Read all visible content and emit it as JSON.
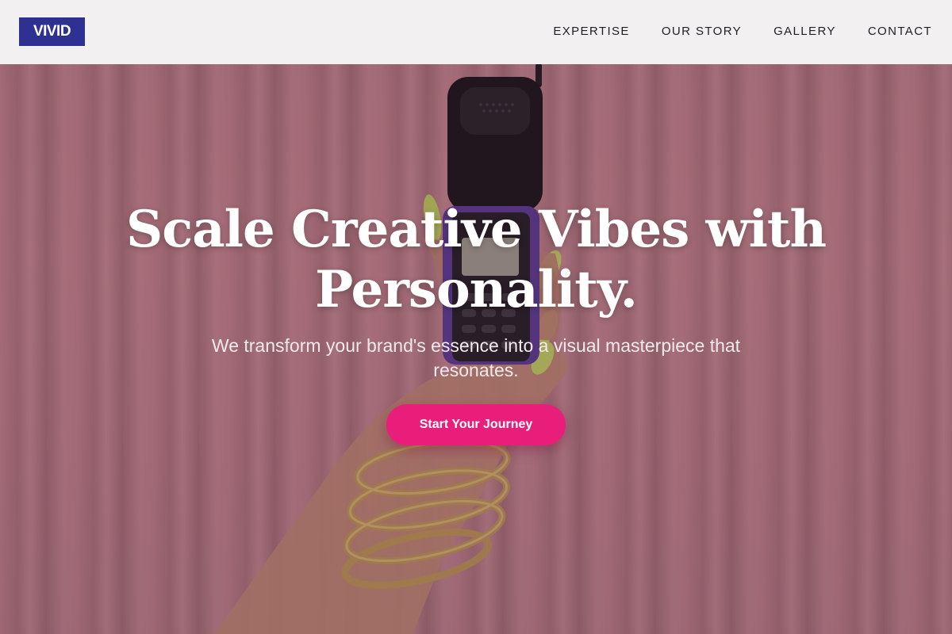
{
  "header": {
    "logo": "VIVID",
    "nav": [
      {
        "label": "EXPERTISE"
      },
      {
        "label": "OUR STORY"
      },
      {
        "label": "GALLERY"
      },
      {
        "label": "CONTACT"
      }
    ]
  },
  "hero": {
    "headline": "Scale Creative Vibes with Personality.",
    "subheadline": "We transform your brand's essence into a visual masterpiece that resonates.",
    "cta_label": "Start Your Journey",
    "background_image": "hand-holding-phone-photo"
  },
  "colors": {
    "logo_bg": "#2e3191",
    "cta_bg": "#e91e7a",
    "header_bg": "#f3f0f1",
    "curtain": "#c98a93"
  }
}
